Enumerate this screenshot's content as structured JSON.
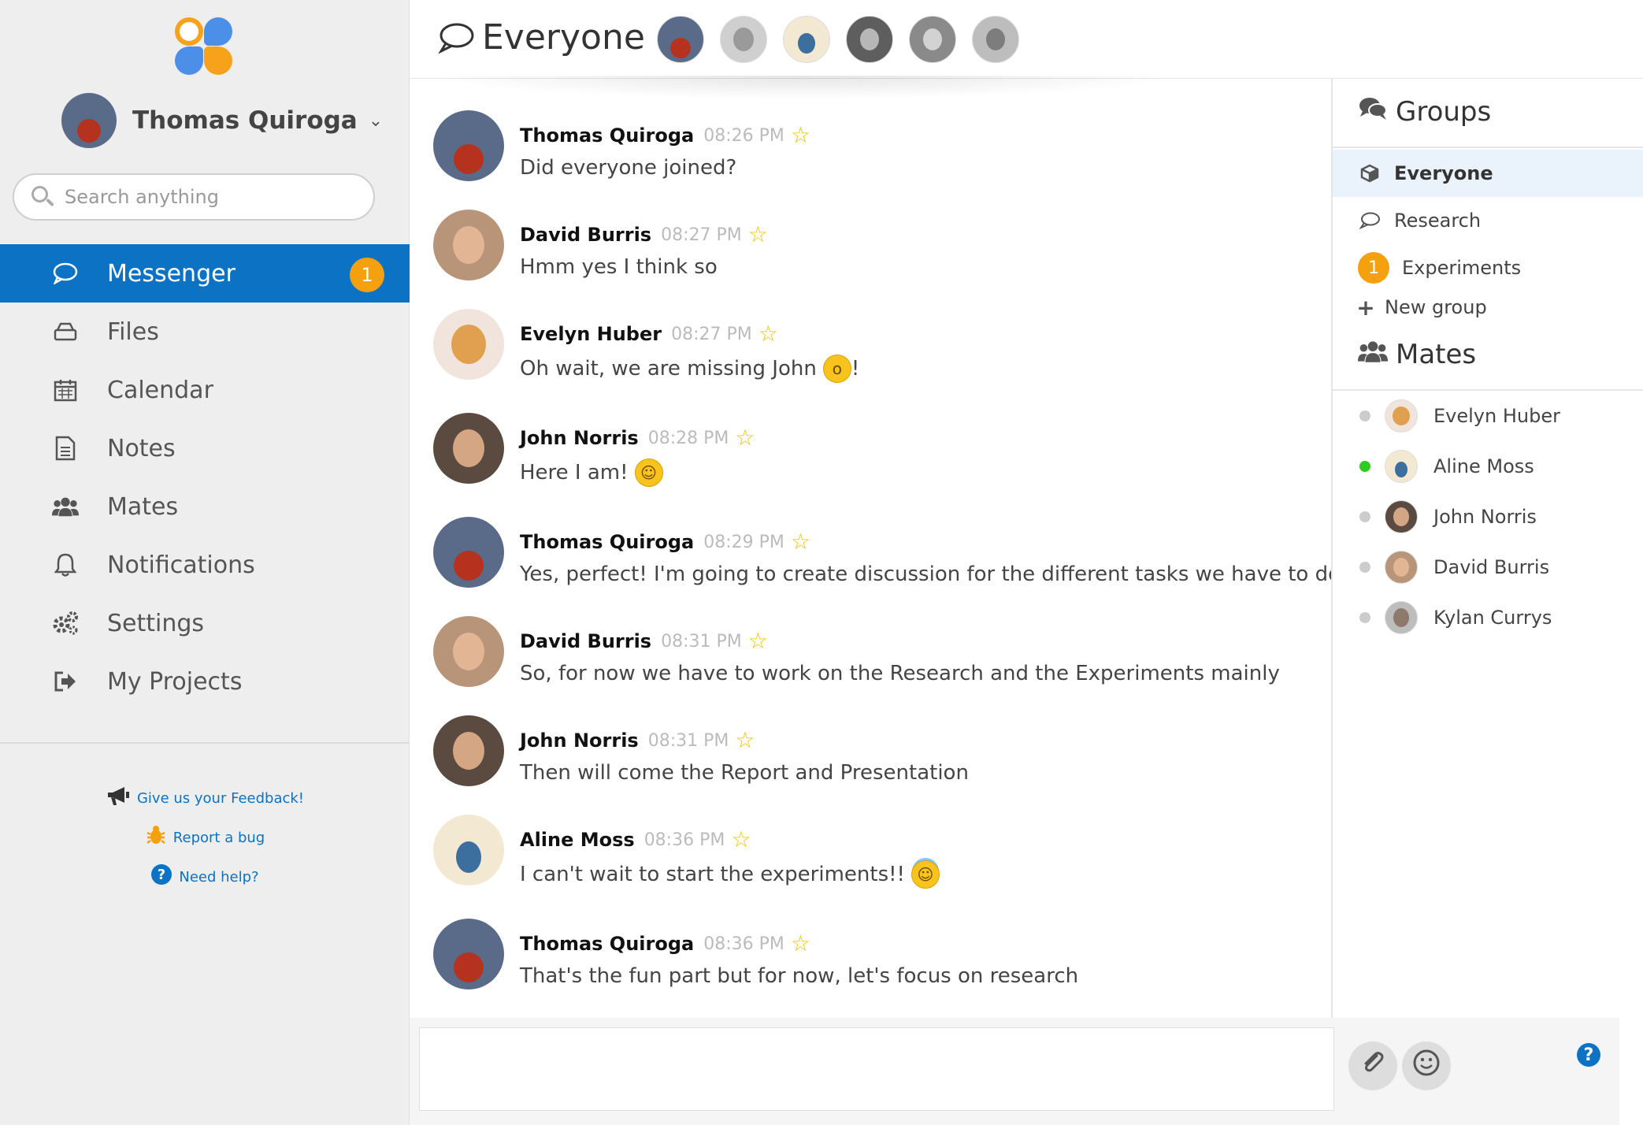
{
  "user": {
    "name": "Thomas Quiroga"
  },
  "search": {
    "placeholder": "Search anything"
  },
  "nav": {
    "items": [
      {
        "label": "Messenger",
        "icon": "chat-bubble-icon",
        "badge": "1",
        "active": true
      },
      {
        "label": "Files",
        "icon": "drive-icon"
      },
      {
        "label": "Calendar",
        "icon": "calendar-icon"
      },
      {
        "label": "Notes",
        "icon": "document-icon"
      },
      {
        "label": "Mates",
        "icon": "users-icon"
      },
      {
        "label": "Notifications",
        "icon": "bell-icon"
      },
      {
        "label": "Settings",
        "icon": "gears-icon"
      },
      {
        "label": "My Projects",
        "icon": "sign-out-icon"
      }
    ]
  },
  "help_links": {
    "feedback": "Give us your Feedback!",
    "bug": "Report a bug",
    "help": "Need help?"
  },
  "header": {
    "title": "Everyone",
    "participants": [
      "Thomas Quiroga",
      "Evelyn Huber",
      "Aline Moss",
      "John Norris",
      "David Burris",
      "Kylan Currys"
    ]
  },
  "messages": [
    {
      "author": "Thomas Quiroga",
      "time": "08:26 PM",
      "text": "Did everyone joined?",
      "emoji": ""
    },
    {
      "author": "David Burris",
      "time": "08:27 PM",
      "text": "Hmm yes I think so",
      "emoji": ""
    },
    {
      "author": "Evelyn Huber",
      "time": "08:27 PM",
      "text": "Oh wait, we are missing John",
      "emoji": "surprised",
      "suffix": "!"
    },
    {
      "author": "John Norris",
      "time": "08:28 PM",
      "text": "Here I am!",
      "emoji": "smile"
    },
    {
      "author": "Thomas Quiroga",
      "time": "08:29 PM",
      "text": "Yes, perfect! I'm going to create discussion for the different tasks we have to do",
      "emoji": ""
    },
    {
      "author": "David Burris",
      "time": "08:31 PM",
      "text": "So, for now we have to work on the Research and the Experiments mainly",
      "emoji": ""
    },
    {
      "author": "John Norris",
      "time": "08:31 PM",
      "text": "Then will come the Report and Presentation",
      "emoji": ""
    },
    {
      "author": "Aline Moss",
      "time": "08:36 PM",
      "text": "I can't wait to start the experiments!!",
      "emoji": "angel"
    },
    {
      "author": "Thomas Quiroga",
      "time": "08:36 PM",
      "text": "That's the fun part but for now, let's focus on research",
      "emoji": ""
    }
  ],
  "groups": {
    "title": "Groups",
    "items": [
      {
        "label": "Everyone",
        "icon": "cube-icon",
        "active": true
      },
      {
        "label": "Research",
        "icon": "chat-bubble-icon"
      },
      {
        "label": "Experiments",
        "badge": "1"
      }
    ],
    "new_group": "New group"
  },
  "mates": {
    "title": "Mates",
    "items": [
      {
        "name": "Evelyn Huber",
        "online": false
      },
      {
        "name": "Aline Moss",
        "online": true
      },
      {
        "name": "John Norris",
        "online": false
      },
      {
        "name": "David Burris",
        "online": false
      },
      {
        "name": "Kylan Currys",
        "online": false
      }
    ]
  },
  "colors": {
    "accent": "#0b72c4",
    "badge": "#f5a00f",
    "online": "#2ecc1f",
    "star": "#f2c200"
  }
}
